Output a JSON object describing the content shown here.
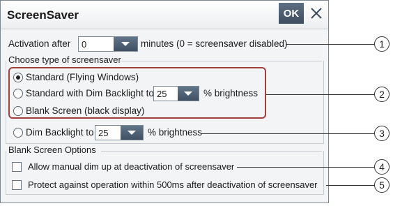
{
  "dialog": {
    "title": "ScreenSaver",
    "ok_label": "OK",
    "close_icon": "close-icon"
  },
  "activation": {
    "label": "Activation after",
    "value": "0",
    "suffix": "minutes (0 = screensaver disabled)"
  },
  "screensaver_type": {
    "group_label": "Choose type of screensaver",
    "options": [
      {
        "label": "Standard (Flying Windows)",
        "selected": true
      },
      {
        "label": "Standard with Dim Backlight to",
        "dropdown_value": "25",
        "suffix": "% brightness",
        "selected": false
      },
      {
        "label": "Blank Screen (black display)",
        "selected": false
      },
      {
        "label": "Dim Backlight to",
        "dropdown_value": "25",
        "suffix": "% brightness",
        "selected": false
      }
    ]
  },
  "blank_screen_options": {
    "group_label": "Blank Screen Options",
    "checkboxes": [
      {
        "label": "Allow manual dim up at deactivation of screensaver",
        "checked": false
      },
      {
        "label": "Protect against operation within 500ms after deactivation of screensaver",
        "checked": false
      }
    ]
  },
  "callouts": [
    "1",
    "2",
    "3",
    "4",
    "5"
  ],
  "colors": {
    "highlight": "#a0413f",
    "button": "#3f5063",
    "background": "#f3f4f5"
  }
}
